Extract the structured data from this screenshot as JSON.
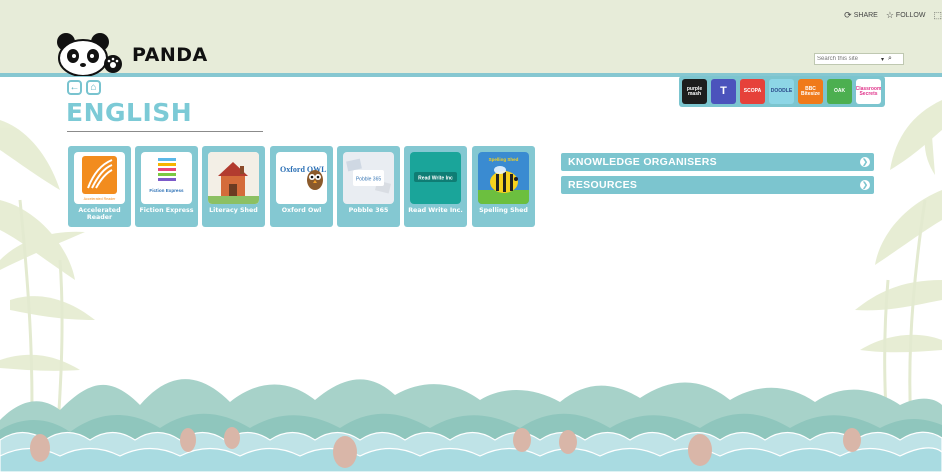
{
  "suitebar": {
    "share_label": "SHARE",
    "follow_label": "FOLLOW",
    "focus_label": "⬚"
  },
  "header": {
    "logo_text": "PANDA"
  },
  "search": {
    "placeholder": "Search this site",
    "scope_arrow": "▾",
    "search_icon": "⌕"
  },
  "nav": {
    "back_icon": "←",
    "home_icon": "⌂"
  },
  "page": {
    "title": "ENGLISH"
  },
  "quicklinks": [
    {
      "name": "purple-mash",
      "label": "purple mash",
      "color": "#1d1d1d"
    },
    {
      "name": "teams",
      "label": "T",
      "color": "#4b53bc"
    },
    {
      "name": "scopa",
      "label": "SCOPA",
      "color": "#e6413a"
    },
    {
      "name": "doodle",
      "label": "DOODLE",
      "color": "#8dd6e6"
    },
    {
      "name": "bbc-bitesize",
      "label": "BBC Bitesize",
      "color": "#f07a1a"
    },
    {
      "name": "oak",
      "label": "OAK",
      "color": "#4caf50"
    },
    {
      "name": "classroom-secrets",
      "label": "Classroom Secrets",
      "color": "#ffffff"
    }
  ],
  "tiles": [
    {
      "name": "accelerated-reader",
      "label": "Accelerated Reader",
      "subtitle": "Accelerated Reader",
      "bg": "#ffffff"
    },
    {
      "name": "fiction-express",
      "label": "Fiction Express",
      "subtitle": "Fiction Express",
      "bg": "#ffffff"
    },
    {
      "name": "literacy-shed",
      "label": "Literacy Shed",
      "subtitle": "",
      "bg": "#ffffff"
    },
    {
      "name": "oxford-owl",
      "label": "Oxford Owl",
      "subtitle": "Oxford OWL",
      "bg": "#ffffff"
    },
    {
      "name": "pobble-365",
      "label": "Pobble 365",
      "subtitle": "Pobble 365",
      "bg": "#ffffff"
    },
    {
      "name": "read-write-inc",
      "label": "Read Write Inc.",
      "subtitle": "Read Write Inc",
      "bg": "#1aa59a"
    },
    {
      "name": "spelling-shed",
      "label": "Spelling Shed",
      "subtitle": "Spelling Shed",
      "bg": "#3a8bd1"
    }
  ],
  "accordion": [
    {
      "label": "KNOWLEDGE ORGANISERS"
    },
    {
      "label": "RESOURCES"
    }
  ],
  "colors": {
    "accent": "#7cc5cf",
    "header_bg": "#e7ecd9",
    "title": "#7ccad6"
  }
}
